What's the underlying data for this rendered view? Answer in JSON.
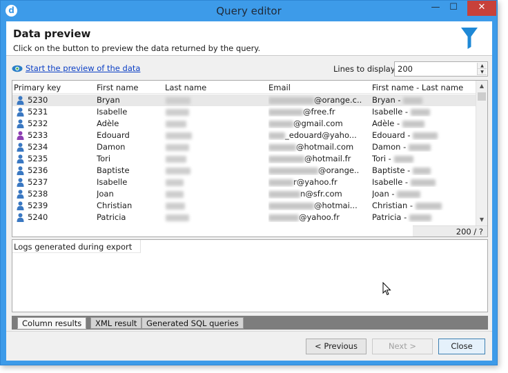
{
  "window": {
    "title": "Query editor",
    "minimize_glyph": "—",
    "maximize_glyph": "☐",
    "close_glyph": "✕",
    "app_icon": "d"
  },
  "header": {
    "title": "Data preview",
    "subtitle": "Click on the button to preview the data returned by the query.",
    "icon": "funnel-icon"
  },
  "preview": {
    "link_label": "Start the preview of the data",
    "icon": "eye-icon",
    "lines_label": "Lines to display:",
    "lines_value": "200"
  },
  "grid": {
    "columns": [
      "Primary key",
      "First name",
      "Last name",
      "Email",
      "First name - Last name"
    ],
    "rows": [
      {
        "key": "5230",
        "first": "Bryan",
        "email_domain": "@orange.c..",
        "full": "Bryan - "
      },
      {
        "key": "5231",
        "first": "Isabelle",
        "email_domain": "@free.fr",
        "full": "Isabelle - "
      },
      {
        "key": "5232",
        "first": "Adèle",
        "email_domain": "@gmail.com",
        "full": "Adèle - "
      },
      {
        "key": "5233",
        "first": "Edouard",
        "email_domain": "_edouard@yaho...",
        "full": "Edouard - "
      },
      {
        "key": "5234",
        "first": "Damon",
        "email_domain": "@hotmail.com",
        "full": "Damon - "
      },
      {
        "key": "5235",
        "first": "Tori",
        "email_domain": "@hotmail.fr",
        "full": "Tori - "
      },
      {
        "key": "5236",
        "first": "Baptiste",
        "email_domain": "@orange..",
        "full": "Baptiste - "
      },
      {
        "key": "5237",
        "first": "Isabelle",
        "email_domain": "r@yahoo.fr",
        "full": "Isabelle - "
      },
      {
        "key": "5238",
        "first": "Joan",
        "email_domain": "n@sfr.com",
        "full": "Joan - "
      },
      {
        "key": "5239",
        "first": "Christian",
        "email_domain": "@hotmai...",
        "full": "Christian - "
      },
      {
        "key": "5240",
        "first": "Patricia",
        "email_domain": "@yahoo.fr",
        "full": "Patricia - "
      }
    ],
    "count": "200 / ?",
    "scroll_up": "▲",
    "scroll_down": "▼"
  },
  "logs": {
    "title": "Logs generated during export"
  },
  "tabs": [
    "Column results",
    "XML result",
    "Generated SQL queries"
  ],
  "buttons": {
    "previous": "< Previous",
    "next": "Next >",
    "close": "Close"
  },
  "colors": {
    "window_frame": "#3d9be9",
    "close_button": "#c7413a",
    "link": "#0b3fc5",
    "funnel": "#1e88d6"
  }
}
